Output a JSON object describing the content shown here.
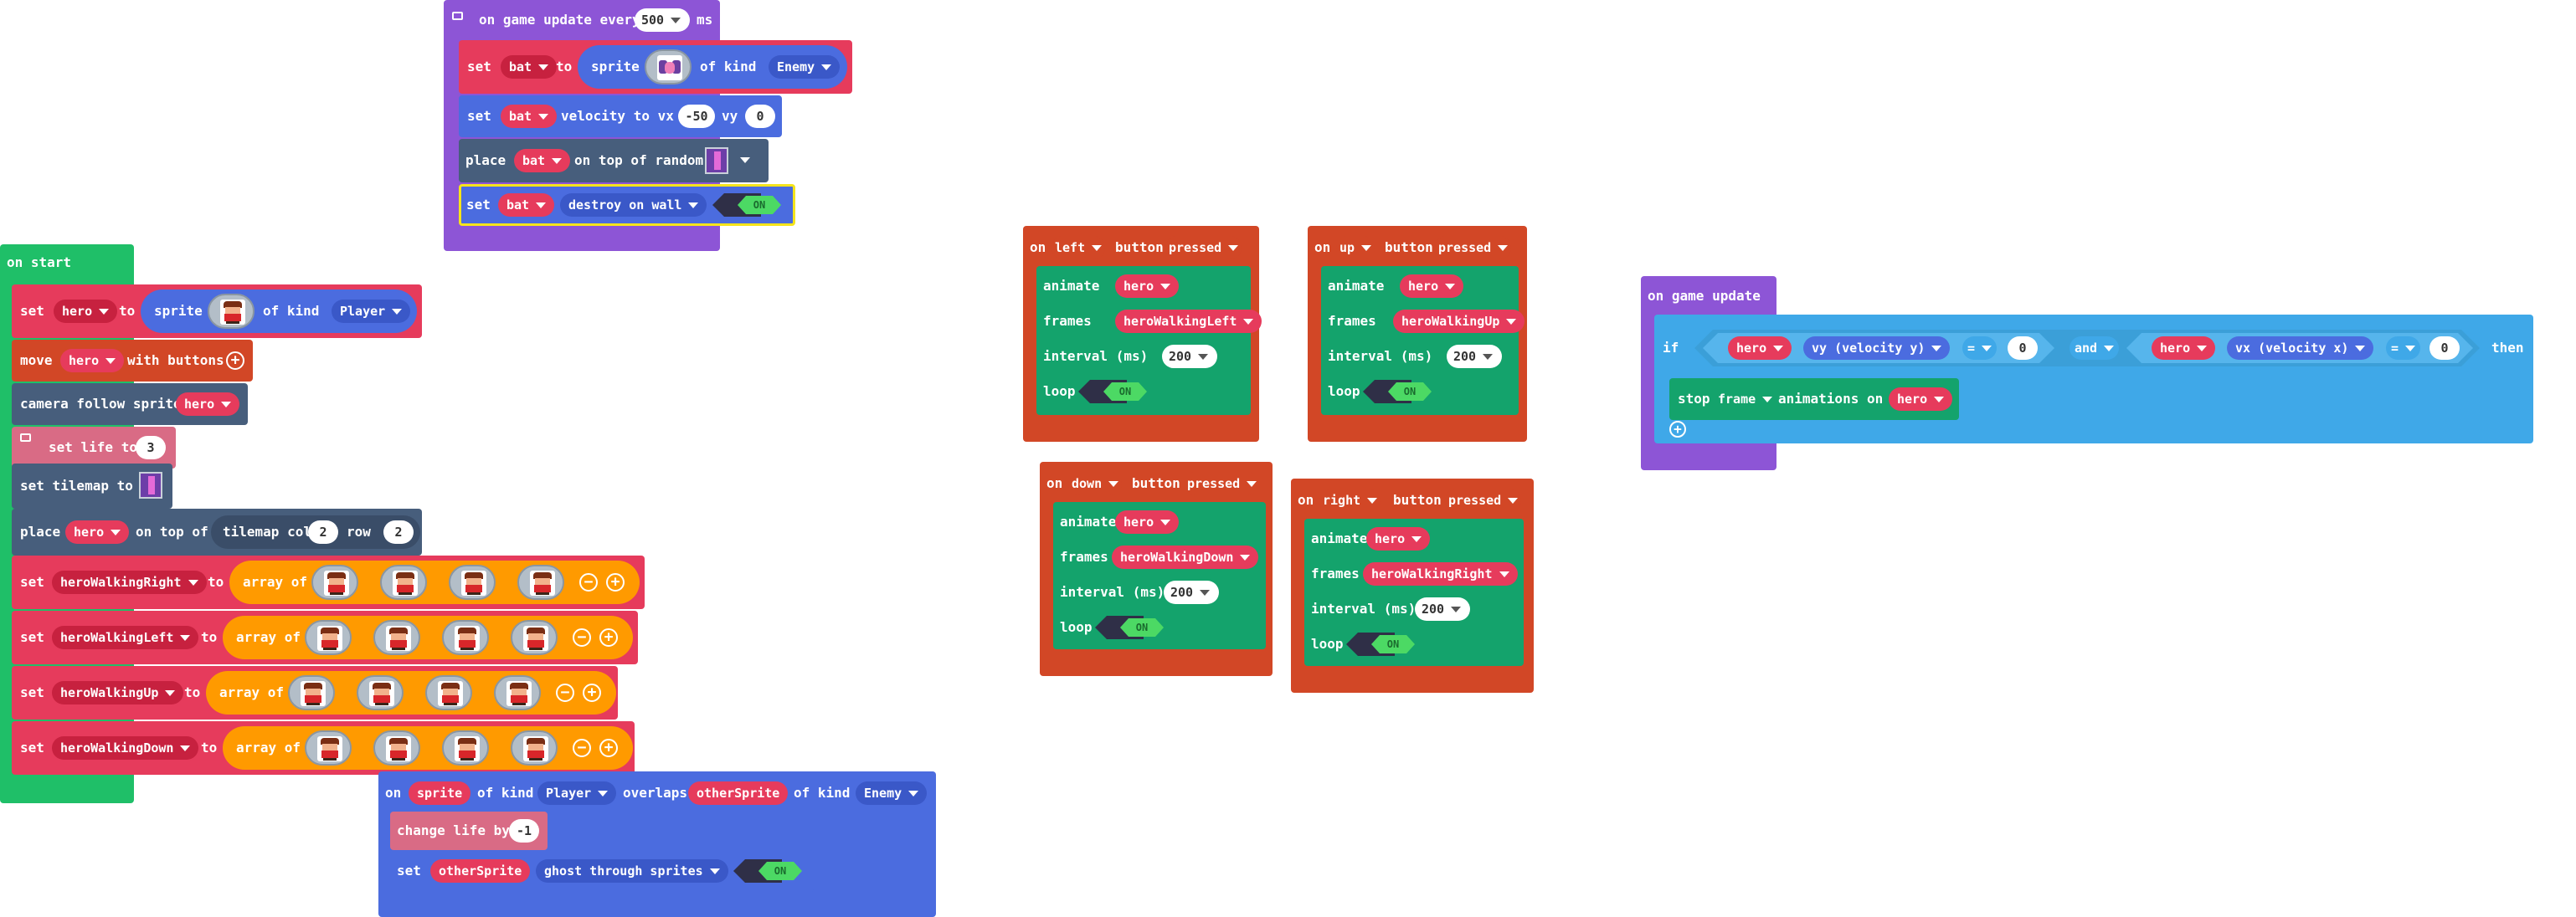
{
  "colors": {
    "events": "#8d55d6",
    "sprites": "#4b6cdf",
    "variables": "#e63b5c",
    "scene": "#475e7c",
    "info": "#d96b85",
    "loops": "#1fbf68",
    "controller": "#d24726",
    "animation": "#14a36c",
    "arrays": "#ff9a00",
    "logic": "#3fa8e8"
  },
  "on_game_update_every": {
    "prefix": "on game update every",
    "interval": "500",
    "suffix": "ms"
  },
  "set_bat": {
    "set": "set",
    "var": "bat",
    "to": "to",
    "sprite": "sprite",
    "of_kind": "of kind",
    "kind": "Enemy"
  },
  "set_bat_velocity": {
    "set": "set",
    "var": "bat",
    "label": "velocity to vx",
    "vx": "-50",
    "vy_label": "vy",
    "vy": "0"
  },
  "place_bat": {
    "place": "place",
    "var": "bat",
    "label": "on top of random"
  },
  "set_bat_flag": {
    "set": "set",
    "var": "bat",
    "flag": "destroy on wall",
    "toggle": "ON"
  },
  "on_start": {
    "title": "on start"
  },
  "set_hero": {
    "set": "set",
    "var": "hero",
    "to": "to",
    "sprite": "sprite",
    "of_kind": "of kind",
    "kind": "Player"
  },
  "move_hero": {
    "move": "move",
    "var": "hero",
    "with": "with buttons"
  },
  "camera": {
    "label": "camera follow sprite",
    "var": "hero"
  },
  "set_life": {
    "label": "set life to",
    "value": "3"
  },
  "set_tilemap": {
    "label": "set tilemap to"
  },
  "place_hero": {
    "place": "place",
    "var": "hero",
    "on_top": "on top of",
    "tilemap_col": "tilemap col",
    "col": "2",
    "row_label": "row",
    "row": "2"
  },
  "arrays": [
    {
      "set": "set",
      "var": "heroWalkingRight",
      "to": "to",
      "array_of": "array of"
    },
    {
      "set": "set",
      "var": "heroWalkingLeft",
      "to": "to",
      "array_of": "array of"
    },
    {
      "set": "set",
      "var": "heroWalkingUp",
      "to": "to",
      "array_of": "array of"
    },
    {
      "set": "set",
      "var": "heroWalkingDown",
      "to": "to",
      "array_of": "array of"
    }
  ],
  "overlap": {
    "on": "on",
    "sprite": "sprite",
    "of_kind": "of kind",
    "kind": "Player",
    "overlaps": "overlaps",
    "other": "otherSprite",
    "of_kind2": "of kind",
    "kind2": "Enemy",
    "change_life": "change life by",
    "life_delta": "-1",
    "set": "set",
    "other2": "otherSprite",
    "flag": "ghost through sprites",
    "toggle": "ON"
  },
  "buttons": [
    {
      "on": "on",
      "button": "left",
      "label": "button",
      "event": "pressed",
      "animate": "animate",
      "var": "hero",
      "frames": "frames",
      "frames_var": "heroWalkingLeft",
      "interval": "interval (ms)",
      "interval_val": "200",
      "loop": "loop",
      "toggle": "ON"
    },
    {
      "on": "on",
      "button": "up",
      "label": "button",
      "event": "pressed",
      "animate": "animate",
      "var": "hero",
      "frames": "frames",
      "frames_var": "heroWalkingUp",
      "interval": "interval (ms)",
      "interval_val": "200",
      "loop": "loop",
      "toggle": "ON"
    },
    {
      "on": "on",
      "button": "down",
      "label": "button",
      "event": "pressed",
      "animate": "animate",
      "var": "hero",
      "frames": "frames",
      "frames_var": "heroWalkingDown",
      "interval": "interval (ms)",
      "interval_val": "200",
      "loop": "loop",
      "toggle": "ON"
    },
    {
      "on": "on",
      "button": "right",
      "label": "button",
      "event": "pressed",
      "animate": "animate",
      "var": "hero",
      "frames": "frames",
      "frames_var": "heroWalkingRight",
      "interval": "interval (ms)",
      "interval_val": "200",
      "loop": "loop",
      "toggle": "ON"
    }
  ],
  "game_update": {
    "title": "on game update",
    "if": "if",
    "var1": "hero",
    "prop1": "vy (velocity y)",
    "op1": "=",
    "val1": "0",
    "and": "and",
    "var2": "hero",
    "prop2": "vx (velocity x)",
    "op2": "=",
    "val2": "0",
    "then": "then",
    "stop": "stop",
    "frame": "frame",
    "anims_on": "animations on",
    "var3": "hero"
  }
}
